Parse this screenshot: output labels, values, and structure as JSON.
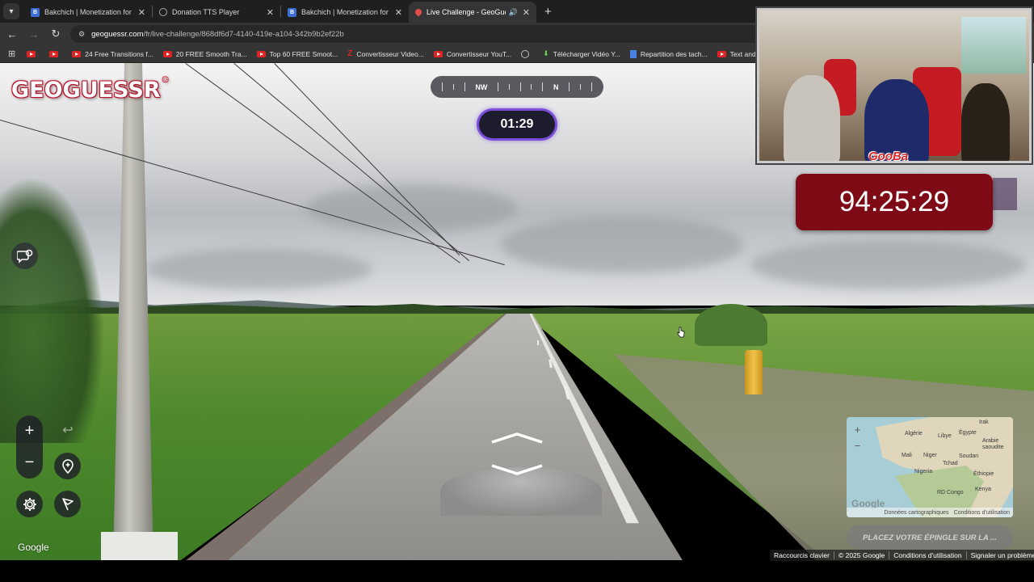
{
  "browser": {
    "tabs": [
      {
        "title": "Bakchich | Monetization for afri",
        "icon": "b-icon",
        "active": false
      },
      {
        "title": "Donation TTS Player",
        "icon": "globe-icon",
        "active": false
      },
      {
        "title": "Bakchich | Monetization for afri",
        "icon": "b-icon",
        "active": false
      },
      {
        "title": "Live Challenge - GeoGuessr",
        "icon": "geoguessr-pin-icon",
        "active": true
      }
    ],
    "url_host": "geoguessr.com",
    "url_path": "/fr/live-challenge/868df6d7-4140-419e-a104-342b9b2ef22b",
    "bookmarks": [
      {
        "label": "",
        "icon": "youtube-icon"
      },
      {
        "label": "",
        "icon": "youtube-icon"
      },
      {
        "label": "24 Free Transitions f...",
        "icon": "youtube-icon"
      },
      {
        "label": "20 FREE Smooth Tra...",
        "icon": "youtube-icon"
      },
      {
        "label": "Top 60 FREE Smoot...",
        "icon": "youtube-icon"
      },
      {
        "label": "Convertisseur Video...",
        "icon": "z-icon"
      },
      {
        "label": "Convertisseur YouT...",
        "icon": "youtube-icon"
      },
      {
        "label": "",
        "icon": "globe-icon"
      },
      {
        "label": "Télécharger Vidéo Y...",
        "icon": "download-icon"
      },
      {
        "label": "Repartition des tach...",
        "icon": "docs-icon"
      },
      {
        "label": "Text and Image ani...",
        "icon": "youtube-icon"
      }
    ]
  },
  "game": {
    "logo": "GEOGUESSR",
    "compass": {
      "left_label": "NW",
      "right_label": "N"
    },
    "timer": "01:29",
    "google_watermark": "Google",
    "guess_button": "PLACEZ VOTRE ÉPINGLE SUR LA ...",
    "footer_links": [
      "Raccourcis clavier",
      "© 2025 Google",
      "Conditions d'utilisation",
      "Signaler un problème"
    ],
    "minimap": {
      "labels": [
        "Irak",
        "Algérie",
        "Libye",
        "Égypte",
        "Arabie saoudite",
        "Mali",
        "Niger",
        "Tchad",
        "Soudan",
        "Nigeria",
        "Éthiopie",
        "RD Congo",
        "Kenya"
      ],
      "footer": [
        "Données cartographiques",
        "Conditions d'utilisation"
      ],
      "watermark": "Google"
    }
  },
  "stream": {
    "webcam_tag": "GooBa",
    "clock": "94:25:29"
  }
}
